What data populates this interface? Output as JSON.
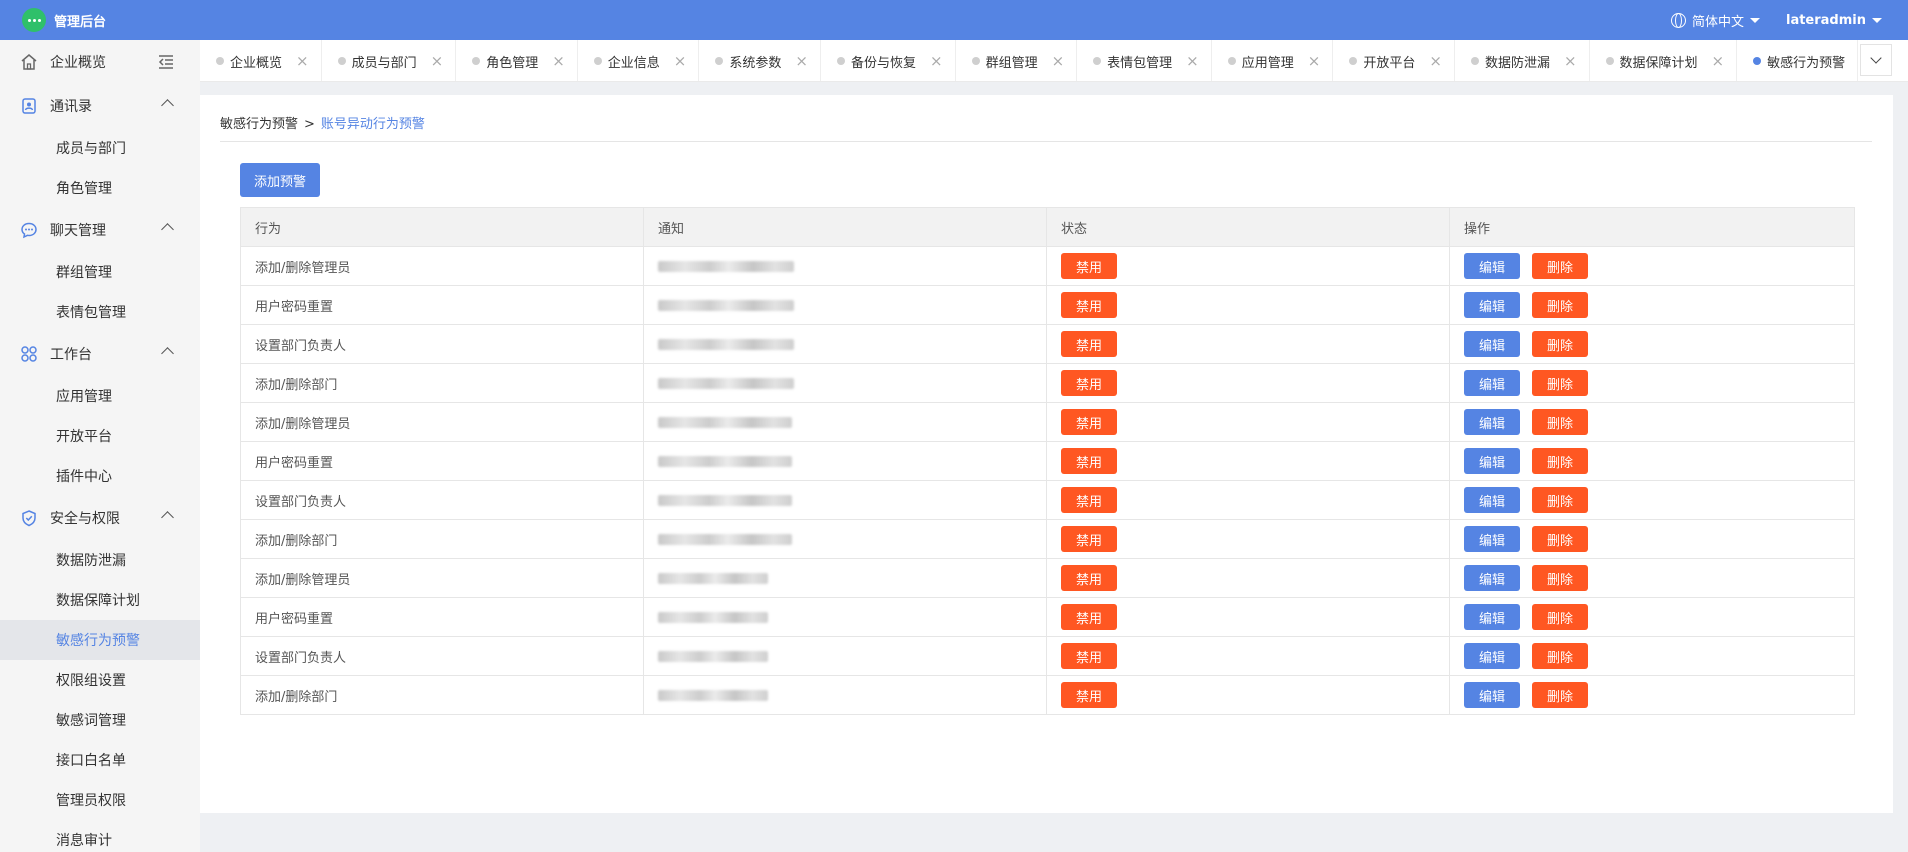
{
  "app": {
    "title": "管理后台",
    "language": "简体中文",
    "username": "lateradmin"
  },
  "sidebar": {
    "top_item": "企业概览",
    "groups": [
      {
        "label": "通讯录",
        "icon": "contacts-icon",
        "items": [
          "成员与部门",
          "角色管理"
        ]
      },
      {
        "label": "聊天管理",
        "icon": "chat-icon",
        "items": [
          "群组管理",
          "表情包管理"
        ]
      },
      {
        "label": "工作台",
        "icon": "workbench-icon",
        "items": [
          "应用管理",
          "开放平台",
          "插件中心"
        ]
      },
      {
        "label": "安全与权限",
        "icon": "shield-icon",
        "items": [
          "数据防泄漏",
          "数据保障计划",
          "敏感行为预警",
          "权限组设置",
          "敏感词管理",
          "接口白名单",
          "管理员权限",
          "消息审计"
        ]
      }
    ],
    "active_item": "敏感行为预警"
  },
  "tabs": [
    "企业概览",
    "成员与部门",
    "角色管理",
    "企业信息",
    "系统参数",
    "备份与恢复",
    "群组管理",
    "表情包管理",
    "应用管理",
    "开放平台",
    "数据防泄漏",
    "数据保障计划",
    "敏感行为预警"
  ],
  "active_tab": "敏感行为预警",
  "breadcrumb": {
    "parent": "敏感行为预警",
    "separator": ">",
    "current": "账号异动行为预警"
  },
  "add_button": "添加预警",
  "table": {
    "headers": [
      "行为",
      "通知",
      "状态",
      "操作"
    ],
    "rows": [
      {
        "action": "添加/删除管理员",
        "status": "禁用",
        "edit": "编辑",
        "delete": "删除"
      },
      {
        "action": "用户密码重置",
        "status": "禁用",
        "edit": "编辑",
        "delete": "删除"
      },
      {
        "action": "设置部门负责人",
        "status": "禁用",
        "edit": "编辑",
        "delete": "删除"
      },
      {
        "action": "添加/删除部门",
        "status": "禁用",
        "edit": "编辑",
        "delete": "删除"
      },
      {
        "action": "添加/删除管理员",
        "status": "禁用",
        "edit": "编辑",
        "delete": "删除"
      },
      {
        "action": "用户密码重置",
        "status": "禁用",
        "edit": "编辑",
        "delete": "删除"
      },
      {
        "action": "设置部门负责人",
        "status": "禁用",
        "edit": "编辑",
        "delete": "删除"
      },
      {
        "action": "添加/删除部门",
        "status": "禁用",
        "edit": "编辑",
        "delete": "删除"
      },
      {
        "action": "添加/删除管理员",
        "status": "禁用",
        "edit": "编辑",
        "delete": "删除"
      },
      {
        "action": "用户密码重置",
        "status": "禁用",
        "edit": "编辑",
        "delete": "删除"
      },
      {
        "action": "设置部门负责人",
        "status": "禁用",
        "edit": "编辑",
        "delete": "删除"
      },
      {
        "action": "添加/删除部门",
        "status": "禁用",
        "edit": "编辑",
        "delete": "删除"
      }
    ]
  },
  "colors": {
    "primary": "#5584e3",
    "danger": "#ff5722",
    "logo": "#2fc06a"
  }
}
